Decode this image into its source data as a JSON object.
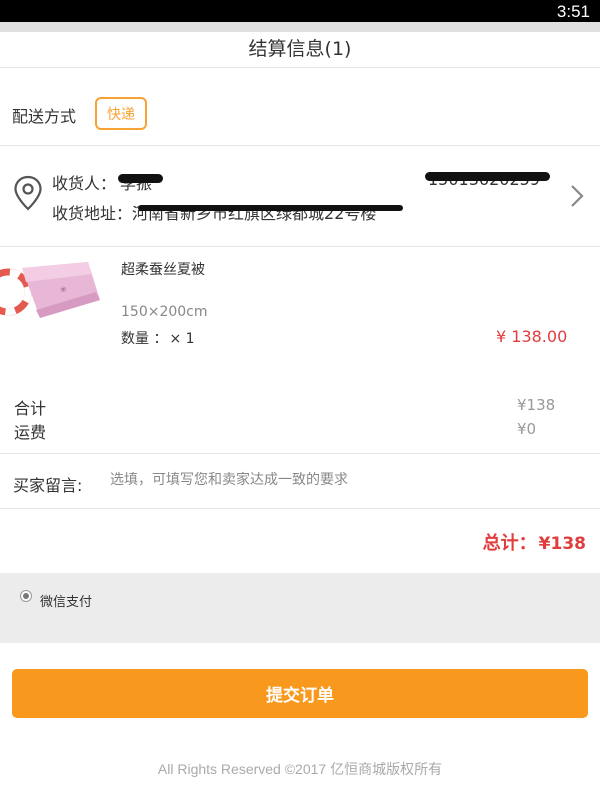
{
  "status_bar": {
    "time": "3:51"
  },
  "header": {
    "title": "结算信息(1)"
  },
  "delivery": {
    "label": "配送方式",
    "method": "快递"
  },
  "receiver": {
    "name_label": "收货人：",
    "name": "李振",
    "phone": "15013620259",
    "address_label": "收货地址：",
    "address": "河南省新乡市红旗区绿都城22号楼",
    "icons": {
      "location": "location-pin-icon",
      "arrow": "chevron-right-icon"
    }
  },
  "product": {
    "name": "超柔蚕丝夏被",
    "spec": "150×200cm",
    "qty_label": "数量 ：",
    "qty": "× 1",
    "price": "¥ 138.00"
  },
  "summary": {
    "subtotal_label": "合计",
    "subtotal": "¥138",
    "shipping_label": "运费",
    "shipping": "¥0"
  },
  "message": {
    "label": "买家留言:",
    "placeholder": "选填，可填写您和卖家达成一致的要求"
  },
  "total": {
    "label": "总计：",
    "value": "¥138"
  },
  "payment": {
    "option": "微信支付",
    "selected": true
  },
  "submit": {
    "label": "提交订单"
  },
  "footer": {
    "text": "All Rights Reserved ©2017 亿恒商城版权所有"
  },
  "colors": {
    "accent_orange": "#f8981d",
    "price_red": "#e23d3d",
    "badge_orange": "#f7a234"
  }
}
